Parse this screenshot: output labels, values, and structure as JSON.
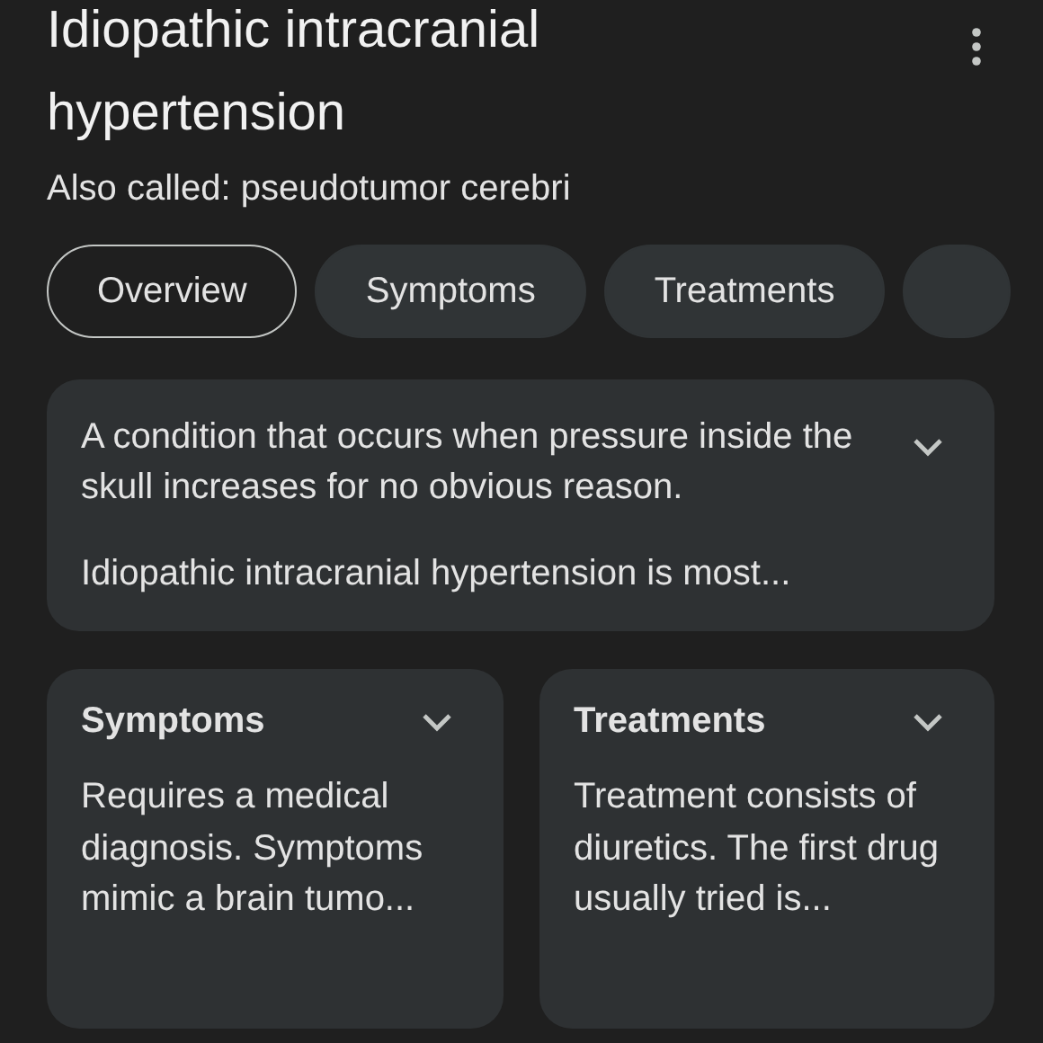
{
  "title": "Idiopathic intracranial hypertension",
  "subtitle": "Also called: pseudotumor cerebri",
  "tabs": [
    {
      "label": "Overview",
      "selected": true
    },
    {
      "label": "Symptoms",
      "selected": false
    },
    {
      "label": "Treatments",
      "selected": false
    }
  ],
  "overview_card": {
    "paragraphs": [
      "A condition that occurs when pressure inside the skull increases for no obvious reason.",
      "Idiopathic intracranial hypertension is most..."
    ],
    "expanded": false
  },
  "cards": [
    {
      "heading": "Symptoms",
      "text": "Requires a medical diagnosis. Symptoms mimic a brain tumo...",
      "expanded": false
    },
    {
      "heading": "Treatments",
      "text": "Treatment consists of diuretics. The first drug usually tried is...",
      "expanded": false
    }
  ]
}
